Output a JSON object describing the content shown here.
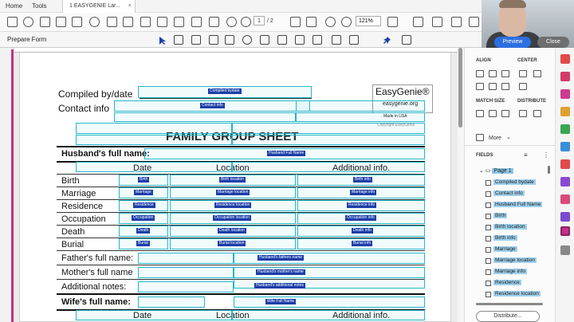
{
  "app": {
    "menu": [
      "Home",
      "Tools"
    ],
    "doc_tab": "1 EASYGENIE Lar...",
    "doc_tab_close": "×",
    "page_current": "1",
    "page_total": "/ 2",
    "zoom": "121%"
  },
  "formbar": {
    "label": "Prepare Form"
  },
  "webcam": {
    "preview": "Preview",
    "close": "Close"
  },
  "form": {
    "compiled_by_date": "Compiled by/date",
    "contact_info": "Contact info",
    "easygenie_brand": "EasyGenie®",
    "easygenie_url": "easygenie.org",
    "made_in_usa": "Made in USA",
    "copyright": "Copyright EasyGenie",
    "title": "FAMILY GROUP SHEET",
    "husband_full_name": "Husband's full name:",
    "col_date": "Date",
    "col_location": "Location",
    "col_additional": "Additional info.",
    "rows": [
      "Birth",
      "Marriage",
      "Residence",
      "Occupation",
      "Death",
      "Burial"
    ],
    "fathers_full_name": "Father's full name:",
    "mothers_full_name": "Mother's full name",
    "additional_notes": "Additional notes:",
    "wifes_full_name": "Wife's full name:",
    "col_date2": "Date",
    "col_location2": "Location",
    "col_additional2": "Additional info."
  },
  "field_chips": {
    "compiled_bydate": "Compiled bydate",
    "contact_info": "Contact info",
    "husband_full_name": "Husband Full Name",
    "birth": "Birth",
    "birth_location": "Birth location",
    "birth_info": "Birth info",
    "marriage": "Marriage",
    "marriage_location": "Marriage location",
    "marriage_info": "Marriage info",
    "residence": "Residence",
    "residence_location": "Residence location",
    "residence_info": "Residence info",
    "occupation": "Occupation",
    "occupation_location": "Occupation location",
    "occupation_info": "Occupation info",
    "death": "Death",
    "death_location": "Death location",
    "death_info": "Death info",
    "burial": "Burial",
    "burial_location": "Burial location",
    "burial_info": "Burial info",
    "husbands_father": "Husband's fathers name",
    "husbands_mother": "Husband's mother's name",
    "husbands_notes": "Husband's additional notes",
    "wife_full_name": "Wife Full Name"
  },
  "panel": {
    "align": "ALIGN",
    "center": "CENTER",
    "match_size": "MATCH SIZE",
    "distribute": "DISTRIBUTE",
    "more": "More",
    "fields": "FIELDS",
    "page_node": "Page 1",
    "field_list": [
      "Compiled bydate",
      "Contact info",
      "Husband Full Name",
      "Birth",
      "Birth location",
      "Birth info",
      "Marriage",
      "Marriage location",
      "Marriage info",
      "Residence",
      "Residence location"
    ],
    "distribute_button": "Distribute..."
  },
  "colors": {
    "field_outline": "#24b6c9",
    "chip": "#1c3ea8",
    "accent_pink": "#c2328a",
    "tree_selection": "#9ed0ec",
    "preview_button": "#2d6fe0"
  }
}
